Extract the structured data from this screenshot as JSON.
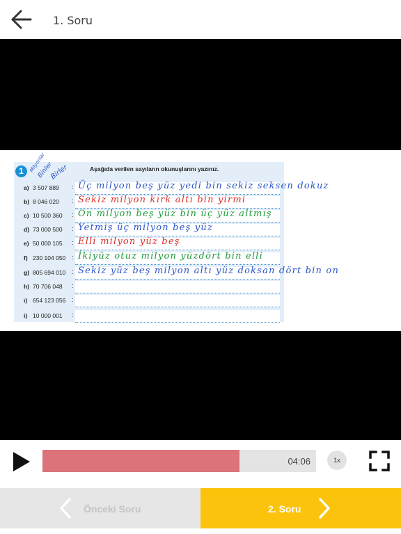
{
  "header": {
    "title": "1. Soru",
    "back_icon": "arrow-left-icon"
  },
  "worksheet": {
    "exercise_number": "1",
    "instruction": "Aşağıda verilen sayıların okunuşlarını yazınız.",
    "margin_notes": [
      "Milyonlar",
      "Binler",
      "Birler"
    ],
    "rows": [
      {
        "letter": "a)",
        "number": "3 507 889",
        "answer": "Üç milyon beş yüz yedi bin sekiz seksen dokuz",
        "ink": "#2a54c8"
      },
      {
        "letter": "b)",
        "number": "8 046 020",
        "answer": "Sekiz milyon kırk altı bin yirmi",
        "ink": "#d9302a"
      },
      {
        "letter": "c)",
        "number": "10 500 360",
        "answer": "On milyon beş yüz bin üç yüz altmış",
        "ink": "#1f9a3a"
      },
      {
        "letter": "d)",
        "number": "73 000 500",
        "answer": "Yetmiş üç milyon beş yüz",
        "ink": "#2a54c8"
      },
      {
        "letter": "e)",
        "number": "50 000 105",
        "answer": "Elli milyon yüz beş",
        "ink": "#d9302a"
      },
      {
        "letter": "f)",
        "number": "230 104 050",
        "answer": "İkiyüz otuz milyon yüzdört bin elli",
        "ink": "#1f9a3a"
      },
      {
        "letter": "g)",
        "number": "805 694 010",
        "answer": "Sekiz yüz beş milyon altı yüz doksan dört bin on",
        "ink": "#2a54c8"
      },
      {
        "letter": "h)",
        "number": "70 706 048",
        "answer": "",
        "ink": "#2a54c8"
      },
      {
        "letter": "ı)",
        "number": "654 123 056",
        "answer": "",
        "ink": "#2a54c8"
      },
      {
        "letter": "i)",
        "number": "10 000 001",
        "answer": "",
        "ink": "#2a54c8"
      }
    ]
  },
  "player": {
    "play_icon": "play-icon",
    "time": "04:06",
    "speed": "1x",
    "progress": 0.72,
    "fullscreen_icon": "fullscreen-icon"
  },
  "footer": {
    "prev_label": "Önceki Soru",
    "next_label": "2. Soru",
    "prev_icon": "chevron-left-icon",
    "next_icon": "chevron-right-icon",
    "accent": "#fcc30c"
  }
}
